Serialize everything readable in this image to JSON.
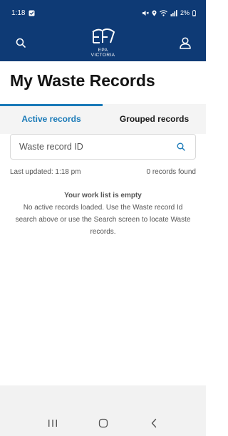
{
  "status_bar": {
    "time": "1:18",
    "battery": "2%"
  },
  "header": {
    "logo_line1": "EPA",
    "logo_line2": "VICTORIA"
  },
  "page": {
    "title": "My Waste Records"
  },
  "tabs": [
    {
      "label": "Active records",
      "active": true
    },
    {
      "label": "Grouped records",
      "active": false
    }
  ],
  "search": {
    "placeholder": "Waste record ID"
  },
  "meta": {
    "last_updated": "Last updated: 1:18 pm",
    "records_found": "0 records found"
  },
  "empty_state": {
    "title": "Your work list is empty",
    "message": "No active records loaded. Use the Waste record Id search above or use the Search screen to locate Waste records."
  },
  "colors": {
    "brand_navy": "#0e3a75",
    "accent_blue": "#1a7ab8"
  }
}
